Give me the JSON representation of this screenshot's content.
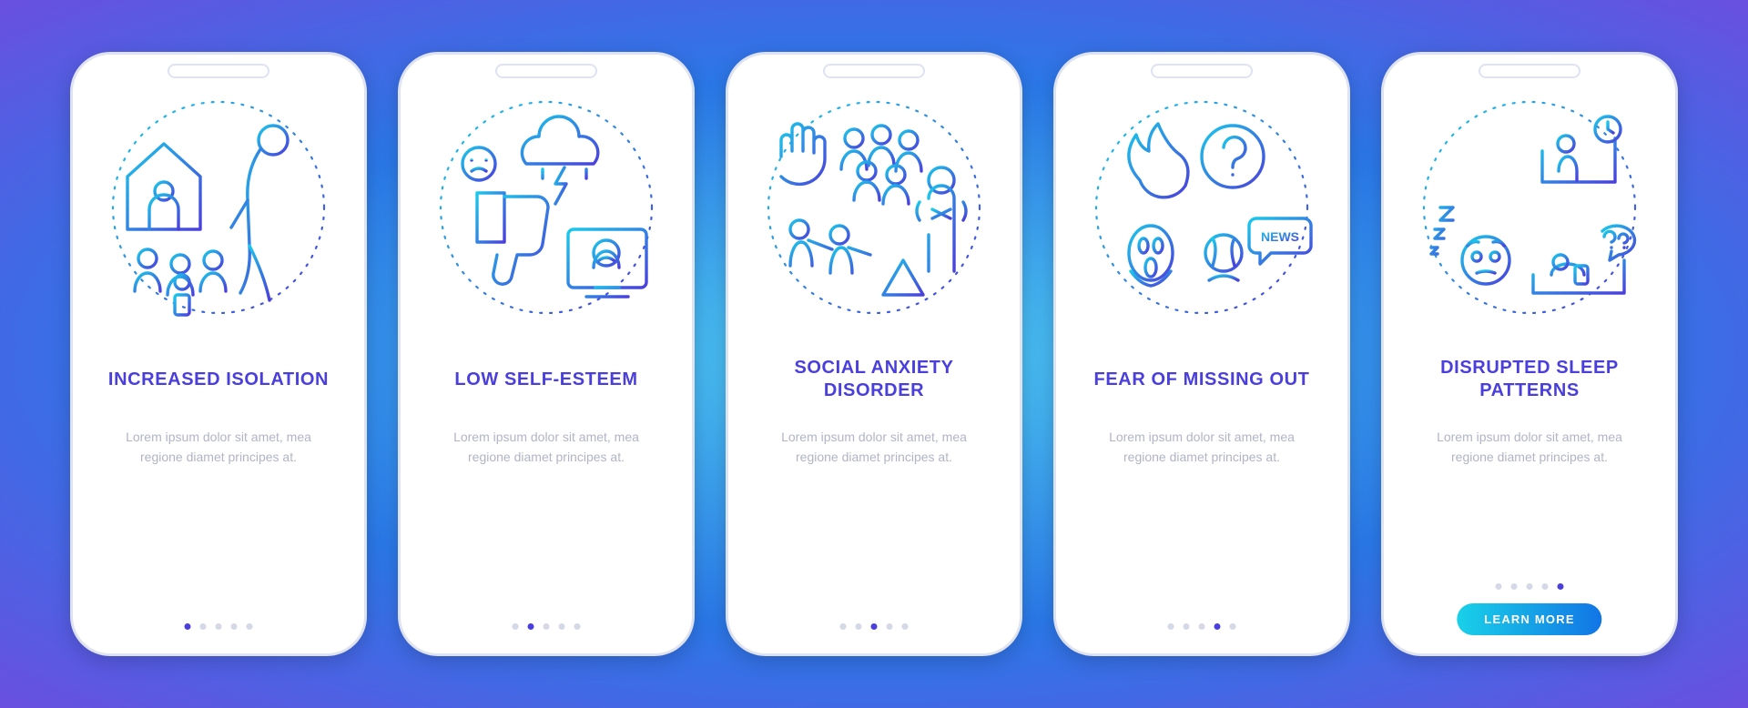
{
  "colors": {
    "title": "#4a3fdc",
    "body": "#b1b4c7",
    "dot_inactive": "#d5d8e6",
    "dot_active": "#4a3fdc",
    "cta_gradient_from": "#19d1e8",
    "cta_gradient_to": "#1275e6"
  },
  "lorem": "Lorem ipsum dolor sit amet, mea regione diamet principes at.",
  "cta_label": "LEARN MORE",
  "screens": [
    {
      "title": "INCREASED ISOLATION",
      "icon": "isolation-icon",
      "dot_count": 5,
      "active_dot": 0,
      "has_cta": false
    },
    {
      "title": "LOW SELF-ESTEEM",
      "icon": "self-esteem-icon",
      "dot_count": 5,
      "active_dot": 1,
      "has_cta": false
    },
    {
      "title": "SOCIAL ANXIETY DISORDER",
      "icon": "anxiety-icon",
      "dot_count": 5,
      "active_dot": 2,
      "has_cta": false
    },
    {
      "title": "FEAR OF MISSING OUT",
      "icon": "fomo-icon",
      "news_badge": "NEWS",
      "dot_count": 5,
      "active_dot": 3,
      "has_cta": false
    },
    {
      "title": "DISRUPTED SLEEP PATTERNS",
      "icon": "sleep-icon",
      "dot_count": 5,
      "active_dot": 4,
      "has_cta": true
    }
  ]
}
